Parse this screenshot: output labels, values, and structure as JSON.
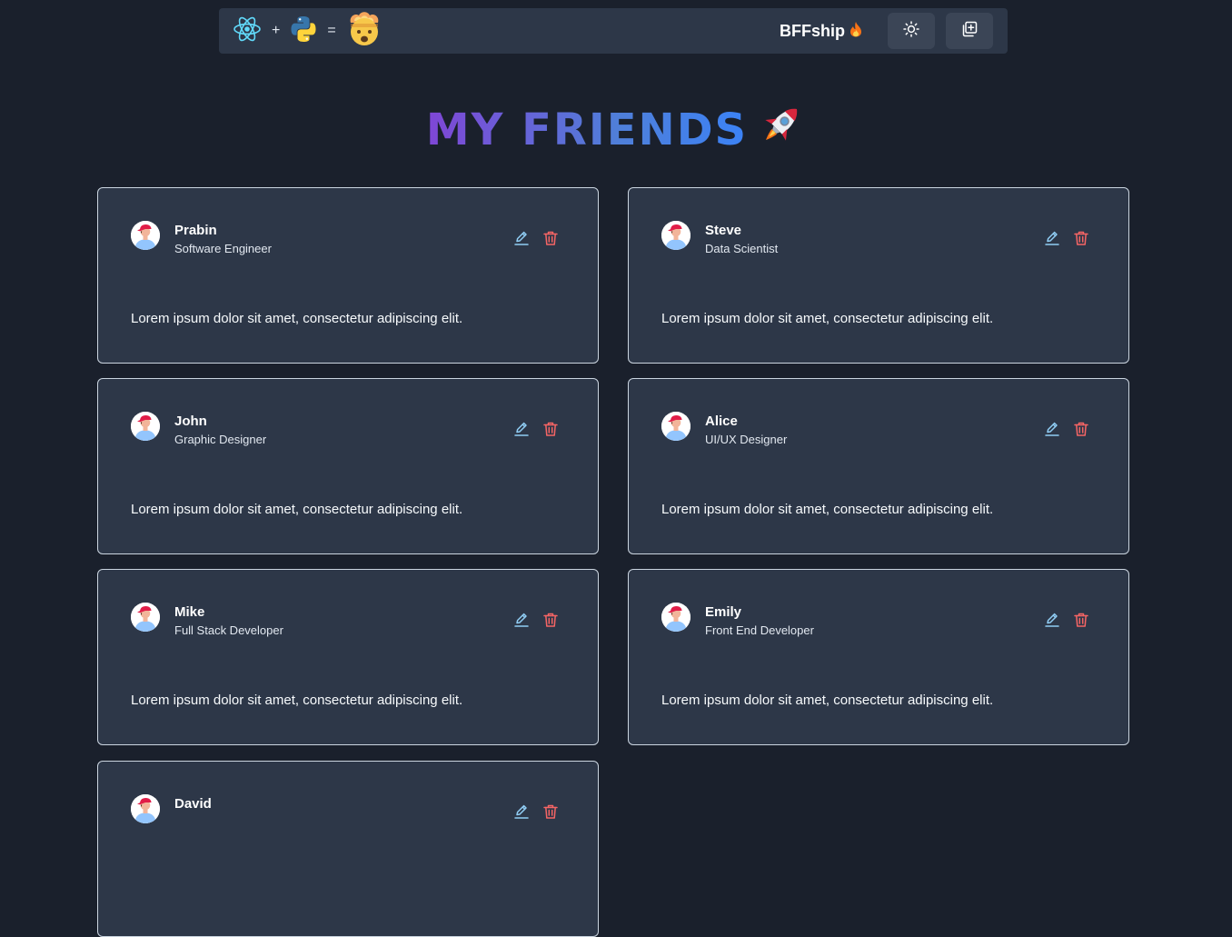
{
  "navbar": {
    "plus_symbol": "+",
    "equals_symbol": "=",
    "brand": "BFFship",
    "left_icons": [
      "react-icon",
      "python-icon",
      "exploding-head-icon"
    ],
    "right_icons": [
      "fire-icon",
      "sun-icon",
      "add-friend-icon"
    ]
  },
  "page": {
    "title": "MY FRIENDS",
    "title_icon": "rocket-icon"
  },
  "colors": {
    "background": "#1a202c",
    "card": "#2d3748",
    "edit_icon": "#90cdf4",
    "delete_icon": "#f56565",
    "title_gradient_start": "#7f46d6",
    "title_gradient_end": "#3b82f6"
  },
  "friends": [
    {
      "name": "Prabin",
      "role": "Software Engineer",
      "description": "Lorem ipsum dolor sit amet, consectetur adipiscing elit."
    },
    {
      "name": "Steve",
      "role": "Data Scientist",
      "description": "Lorem ipsum dolor sit amet, consectetur adipiscing elit."
    },
    {
      "name": "John",
      "role": "Graphic Designer",
      "description": "Lorem ipsum dolor sit amet, consectetur adipiscing elit."
    },
    {
      "name": "Alice",
      "role": "UI/UX Designer",
      "description": "Lorem ipsum dolor sit amet, consectetur adipiscing elit."
    },
    {
      "name": "Mike",
      "role": "Full Stack Developer",
      "description": "Lorem ipsum dolor sit amet, consectetur adipiscing elit."
    },
    {
      "name": "Emily",
      "role": "Front End Developer",
      "description": "Lorem ipsum dolor sit amet, consectetur adipiscing elit."
    },
    {
      "name": "David",
      "role": "",
      "description": ""
    }
  ]
}
